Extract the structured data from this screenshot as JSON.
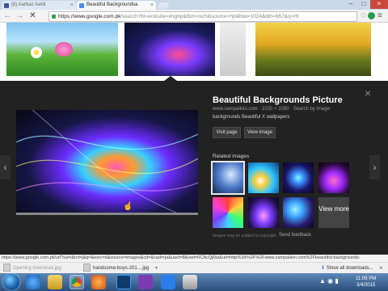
{
  "tabs": [
    {
      "title": "(8) Aarbaz Aahil"
    },
    {
      "title": "Beautiful Backgroundsa"
    }
  ],
  "window": {
    "minimize": "–",
    "maximize": "□",
    "close": "×"
  },
  "toolbar": {
    "back": "←",
    "forward": "→",
    "reload": "✕",
    "url_host": "https://www.google.com.pk",
    "url_rest": "/search?hl=en&site=imghp&tbm=isch&source=hp&biw=1024&bih=667&q=Hi",
    "star": "☆",
    "menu": "≡"
  },
  "preview": {
    "title": "Beautiful Backgrounds Picture",
    "meta": "www.sampaikini.com · 1020 × 1090 · Search by image",
    "description": "backgrounds Beautiful X wallpapers",
    "visit_page": "Visit page",
    "view_image": "View image",
    "related_heading": "Related images",
    "view_more": "View more",
    "copyright": "Images may be subject to copyright.",
    "feedback": "Send feedback",
    "close": "×",
    "prev": "‹",
    "next": "›"
  },
  "status_url": "https://www.google.com.pk/url?sa=i&rct=j&q=&esrc=s&source=images&cd=&cad=rja&uact=8&ved=0CAcQjRw&url=http%3A%2F%2Fwww.sampaikini.com%2Fbeautiful-backgrounds-",
  "downloads": {
    "item1": "Opening download.jpg",
    "item2": "handsome-boys-201....jpg",
    "show_all": "Show all downloads...",
    "close": "×"
  },
  "taskbar": {
    "time": "11:06 PM",
    "date": "3/4/2015"
  },
  "colors": {
    "panel_bg": "#222222",
    "taskbar": "#2b4f7c",
    "close_red": "#c94a3d"
  }
}
